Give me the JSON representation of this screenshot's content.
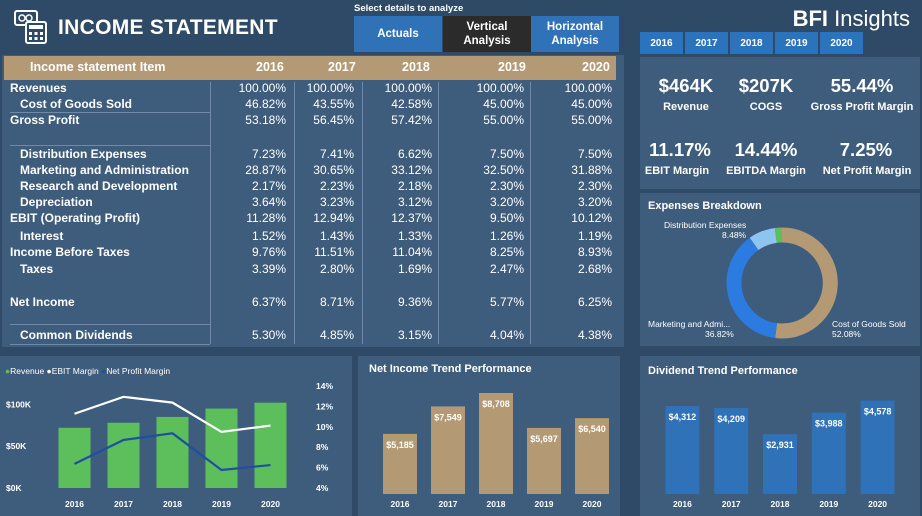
{
  "header": {
    "title": "INCOME STATEMENT",
    "select_label": "Select  details to analyze",
    "buttons": [
      "Actuals",
      "Vertical\nAnalysis",
      "Horizontal\nAnalysis"
    ],
    "brand_bold": "BFI",
    "brand_rest": " Insights",
    "years": [
      "2016",
      "2017",
      "2018",
      "2019",
      "2020"
    ],
    "colors": {
      "background": "#2f4a66",
      "panel": "#3e5c7c",
      "button": "#2f72b8",
      "active_button": "#2b2b2b",
      "header_row": "#b49a74"
    }
  },
  "table": {
    "columns": [
      "Income statement Item",
      "2016",
      "2017",
      "2018",
      "2019",
      "2020"
    ],
    "rows": [
      {
        "label": "Revenues",
        "indent": false,
        "values": [
          "100.00%",
          "100.00%",
          "100.00%",
          "100.00%",
          "100.00%"
        ]
      },
      {
        "label": "Cost of Goods Sold",
        "indent": true,
        "values": [
          "46.82%",
          "43.55%",
          "42.58%",
          "45.00%",
          "45.00%"
        ]
      },
      {
        "label": "Gross Profit",
        "indent": false,
        "values": [
          "53.18%",
          "56.45%",
          "57.42%",
          "55.00%",
          "55.00%"
        ]
      },
      {
        "label": "Distribution Expenses",
        "indent": true,
        "values": [
          "7.23%",
          "7.41%",
          "6.62%",
          "7.50%",
          "7.50%"
        ]
      },
      {
        "label": "Marketing and Administration",
        "indent": true,
        "values": [
          "28.87%",
          "30.65%",
          "33.12%",
          "32.50%",
          "31.88%"
        ]
      },
      {
        "label": "Research and Development",
        "indent": true,
        "values": [
          "2.17%",
          "2.23%",
          "2.18%",
          "2.30%",
          "2.30%"
        ]
      },
      {
        "label": "Depreciation",
        "indent": true,
        "values": [
          "3.64%",
          "3.23%",
          "3.12%",
          "3.20%",
          "3.20%"
        ]
      },
      {
        "label": "EBIT (Operating Profit)",
        "indent": false,
        "values": [
          "11.28%",
          "12.94%",
          "12.37%",
          "9.50%",
          "10.12%"
        ]
      },
      {
        "label": "Interest",
        "indent": true,
        "values": [
          "1.52%",
          "1.43%",
          "1.33%",
          "1.26%",
          "1.19%"
        ]
      },
      {
        "label": "Income Before Taxes",
        "indent": false,
        "values": [
          "9.76%",
          "11.51%",
          "11.04%",
          "8.25%",
          "8.93%"
        ]
      },
      {
        "label": "Taxes",
        "indent": true,
        "values": [
          "3.39%",
          "2.80%",
          "1.69%",
          "2.47%",
          "2.68%"
        ]
      },
      {
        "label": "Net Income",
        "indent": false,
        "values": [
          "6.37%",
          "8.71%",
          "9.36%",
          "5.77%",
          "6.25%"
        ]
      },
      {
        "label": "Common Dividends",
        "indent": true,
        "values": [
          "5.30%",
          "4.85%",
          "3.15%",
          "4.04%",
          "4.38%"
        ]
      }
    ]
  },
  "kpis": [
    {
      "value": "$464K",
      "label": "Revenue"
    },
    {
      "value": "$207K",
      "label": "COGS"
    },
    {
      "value": "55.44%",
      "label": "Gross Profit Margin"
    },
    {
      "value": "11.17%",
      "label": "EBIT Margin"
    },
    {
      "value": "14.44%",
      "label": "EBITDA Margin"
    },
    {
      "value": "7.25%",
      "label": "Net Profit Margin"
    }
  ],
  "expenses": {
    "title": "Expenses Breakdown",
    "labels": {
      "distribution": "Distribution Expenses",
      "distribution_pct": "8.48%",
      "marketing": "Marketing and Admi...",
      "marketing_pct": "36.82%",
      "cogs": "Cost of Goods Sold",
      "cogs_pct": "52.08%"
    }
  },
  "chart_data": [
    {
      "type": "bar",
      "title": "",
      "legend": [
        "Revenue",
        "EBIT Margin",
        "Net Profit Margin"
      ],
      "legend_placement": "top-left",
      "categories": [
        "2016",
        "2017",
        "2018",
        "2019",
        "2020"
      ],
      "series": [
        {
          "name": "Revenue",
          "kind": "bar",
          "axis": "left",
          "color": "#5cbf5c",
          "values": [
            72,
            78,
            85,
            95,
            102
          ]
        },
        {
          "name": "EBIT Margin",
          "kind": "line",
          "axis": "right",
          "color": "#ffffff",
          "values": [
            11.28,
            12.94,
            12.37,
            9.5,
            10.12
          ]
        },
        {
          "name": "Net Profit Margin",
          "kind": "line",
          "axis": "right",
          "color": "#1f4fa0",
          "values": [
            6.37,
            8.71,
            9.36,
            5.77,
            6.25
          ]
        }
      ],
      "y_ticks": [
        "$0K",
        "$50K",
        "$100K"
      ],
      "ylim": [
        0,
        110
      ],
      "y2_ticks": [
        "4%",
        "6%",
        "8%",
        "10%",
        "12%",
        "14%"
      ],
      "y2lim": [
        4,
        14
      ]
    },
    {
      "type": "bar",
      "title": "Net Income Trend Performance",
      "categories": [
        "2016",
        "2017",
        "2018",
        "2019",
        "2020"
      ],
      "values": [
        5185,
        7549,
        8708,
        5697,
        6540
      ],
      "labels": [
        "$5,185",
        "$7,549",
        "$8,708",
        "$5,697",
        "$6,540"
      ],
      "color": "#b49a74",
      "ylim": [
        0,
        10000
      ]
    },
    {
      "type": "bar",
      "title": "Dividend Trend Performance",
      "categories": [
        "2016",
        "2017",
        "2018",
        "2019",
        "2020"
      ],
      "values": [
        4312,
        4209,
        2931,
        3988,
        4578
      ],
      "labels": [
        "$4,312",
        "$4,209",
        "$2,931",
        "$3,988",
        "$4,578"
      ],
      "color": "#2f72b8",
      "ylim": [
        0,
        5000
      ]
    }
  ]
}
